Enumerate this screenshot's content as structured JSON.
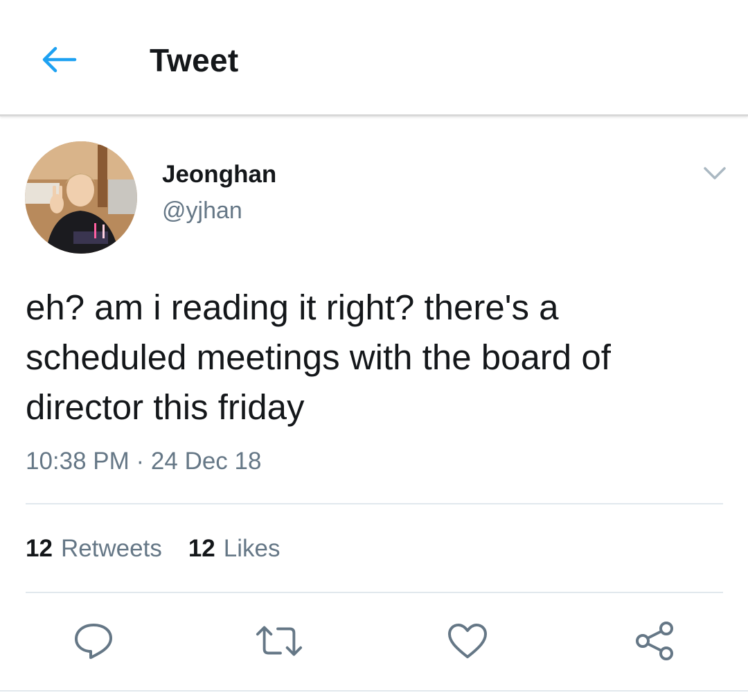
{
  "header": {
    "back_icon": "arrow-left-icon",
    "title": "Tweet",
    "accent_color": "#1da1f2"
  },
  "tweet": {
    "author": {
      "display_name": "Jeonghan",
      "handle": "@yjhan",
      "avatar": "profile-photo"
    },
    "text": "eh? am i reading it right? there's a scheduled meetings with the board of director this friday",
    "timestamp": "10:38 PM · 24 Dec 18",
    "stats": {
      "retweets_count": "12",
      "retweets_label": "Retweets",
      "likes_count": "12",
      "likes_label": "Likes"
    },
    "actions": [
      {
        "name": "reply",
        "icon": "reply-icon"
      },
      {
        "name": "retweet",
        "icon": "retweet-icon"
      },
      {
        "name": "like",
        "icon": "heart-icon"
      },
      {
        "name": "share",
        "icon": "share-icon"
      }
    ]
  },
  "colors": {
    "text_primary": "#14171a",
    "text_secondary": "#657786",
    "divider": "#e1e8ed"
  }
}
